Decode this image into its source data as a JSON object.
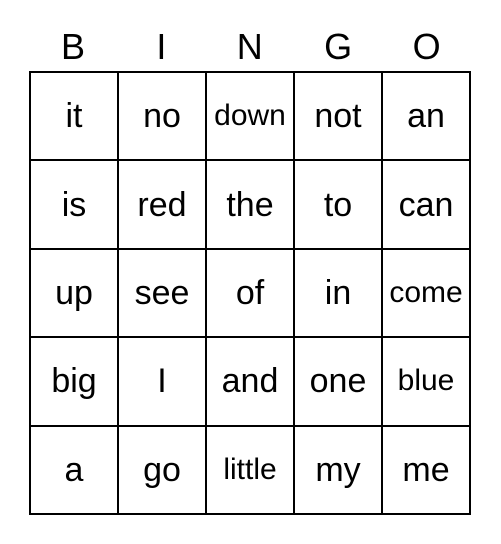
{
  "card": {
    "title": "BINGO",
    "columns": [
      "B",
      "I",
      "N",
      "G",
      "O"
    ],
    "grid_size": "5x5",
    "colors": {
      "background": "#ffffff",
      "text": "#000000",
      "border": "#000000"
    },
    "rows": [
      {
        "cells": [
          {
            "text": "it"
          },
          {
            "text": "no"
          },
          {
            "text": "down"
          },
          {
            "text": "not"
          },
          {
            "text": "an"
          }
        ]
      },
      {
        "cells": [
          {
            "text": "is"
          },
          {
            "text": "red"
          },
          {
            "text": "the"
          },
          {
            "text": "to"
          },
          {
            "text": "can"
          }
        ]
      },
      {
        "cells": [
          {
            "text": "up"
          },
          {
            "text": "see"
          },
          {
            "text": "of"
          },
          {
            "text": "in"
          },
          {
            "text": "come"
          }
        ]
      },
      {
        "cells": [
          {
            "text": "big"
          },
          {
            "text": "I"
          },
          {
            "text": "and"
          },
          {
            "text": "one"
          },
          {
            "text": "blue"
          }
        ]
      },
      {
        "cells": [
          {
            "text": "a"
          },
          {
            "text": "go"
          },
          {
            "text": "little"
          },
          {
            "text": "my"
          },
          {
            "text": "me"
          }
        ]
      }
    ]
  }
}
